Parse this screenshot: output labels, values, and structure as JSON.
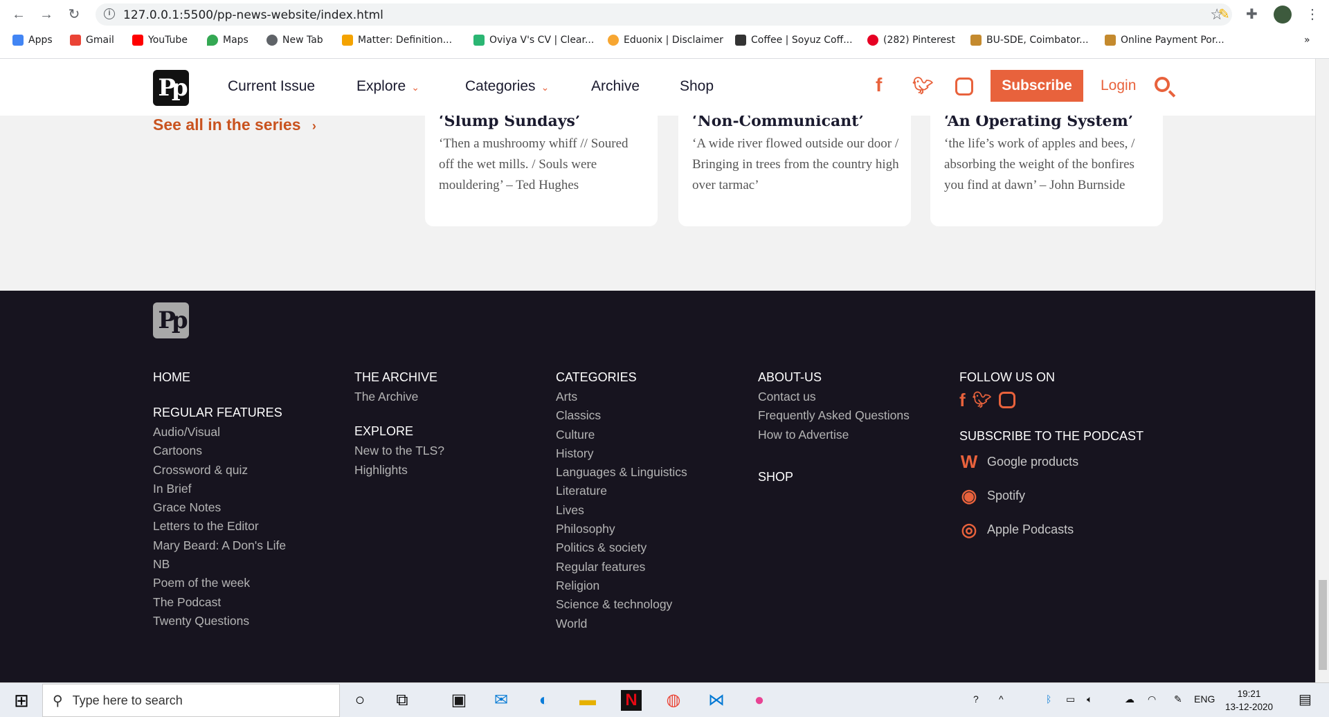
{
  "browser": {
    "url": "127.0.0.1:5500/pp-news-website/index.html",
    "bookmarks": [
      {
        "label": "Apps",
        "color": "#4285f4"
      },
      {
        "label": "Gmail",
        "color": "#ea4335"
      },
      {
        "label": "YouTube",
        "color": "#ff0000"
      },
      {
        "label": "Maps",
        "color": "#34a853"
      },
      {
        "label": "New Tab",
        "color": "#5f6368"
      },
      {
        "label": "Matter: Definition...",
        "color": "#f4a300"
      },
      {
        "label": "Oviya V's CV | Clear...",
        "color": "#2bb673"
      },
      {
        "label": "Eduonix | Disclaimer",
        "color": "#f7a631"
      },
      {
        "label": "Coffee | Soyuz Coff...",
        "color": "#333333"
      },
      {
        "label": "(282) Pinterest",
        "color": "#e60023"
      },
      {
        "label": "BU-SDE, Coimbator...",
        "color": "#c48a2e"
      },
      {
        "label": "Online Payment Por...",
        "color": "#c48a2e"
      }
    ],
    "more": "»"
  },
  "header": {
    "logo": "Pp",
    "nav": {
      "current_issue": "Current Issue",
      "explore": "Explore",
      "categories": "Categories",
      "archive": "Archive",
      "shop": "Shop"
    },
    "subscribe": "Subscribe",
    "login": "Login",
    "accent": "#e8623c"
  },
  "series": {
    "see_all": "See all in the series",
    "cards": [
      {
        "title": "‘Slump Sundays’",
        "quote": "‘Then a mushroomy whiff // Soured off the wet mills. / Souls were mouldering’ – Ted Hughes"
      },
      {
        "title": "‘Non-Communicant’",
        "quote": "‘A wide river flowed outside our door / Bringing in trees from the country high over tarmac’"
      },
      {
        "title": "‘An Operating System’",
        "quote": "‘the life’s work of apples and bees, / absorbing the weight of the bonfires you find at dawn’ – John Burnside"
      }
    ]
  },
  "footer": {
    "logo": "Pp",
    "home": "HOME",
    "regular_features": {
      "heading": "REGULAR FEATURES",
      "items": [
        "Audio/Visual",
        "Cartoons",
        "Crossword & quiz",
        "In Brief",
        "Grace Notes",
        "Letters to the Editor",
        "Mary Beard: A Don's Life",
        "NB",
        "Poem of the week",
        "The Podcast",
        "Twenty Questions"
      ]
    },
    "archive": {
      "heading": "THE ARCHIVE",
      "items": [
        "The Archive"
      ]
    },
    "explore": {
      "heading": "EXPLORE",
      "items": [
        "New to the TLS?",
        "Highlights"
      ]
    },
    "categories": {
      "heading": "CATEGORIES",
      "items": [
        "Arts",
        "Classics",
        "Culture",
        "History",
        "Languages & Linguistics",
        "Literature",
        "Lives",
        "Philosophy",
        "Politics & society",
        "Regular features",
        "Religion",
        "Science & technology",
        "World"
      ]
    },
    "about": {
      "heading": "ABOUT-US",
      "items": [
        "Contact us",
        "Frequently Asked Questions",
        "How to Advertise"
      ]
    },
    "shop": "SHOP",
    "follow": "FOLLOW US ON",
    "podcast": {
      "heading": "SUBSCRIBE TO THE PODCAST",
      "items": [
        "Google products",
        "Spotify",
        "Apple Podcasts"
      ]
    }
  },
  "taskbar": {
    "search_placeholder": "Type here to search",
    "lang": "ENG",
    "time": "19:21",
    "date": "13-12-2020"
  }
}
